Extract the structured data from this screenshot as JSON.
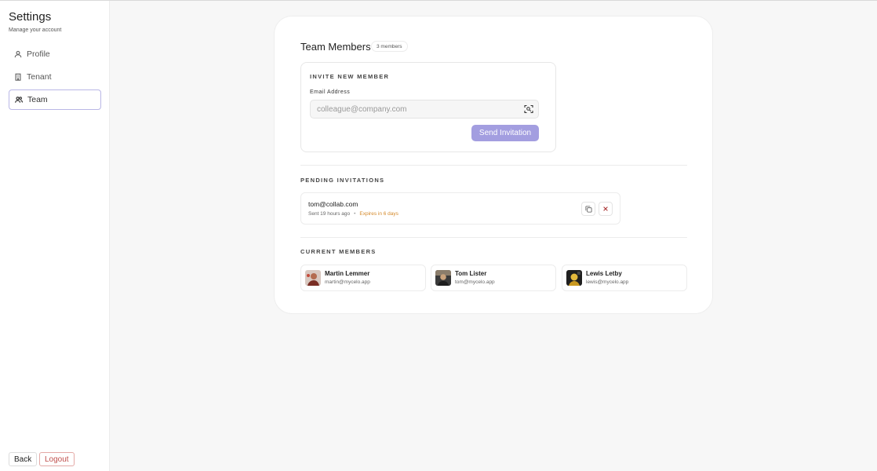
{
  "sidebar": {
    "title": "Settings",
    "subtitle": "Manage your account",
    "items": [
      {
        "label": "Profile",
        "icon": "user-icon"
      },
      {
        "label": "Tenant",
        "icon": "building-icon"
      },
      {
        "label": "Team",
        "icon": "users-icon",
        "active": true
      }
    ],
    "back_label": "Back",
    "logout_label": "Logout"
  },
  "team": {
    "title": "Team Members",
    "count_badge": "3 members",
    "invite": {
      "section_label": "INVITE NEW MEMBER",
      "email_label": "Email Address",
      "email_placeholder": "colleague@company.com",
      "email_value": "",
      "send_label": "Send Invitation"
    },
    "pending": {
      "section_label": "PENDING INVITATIONS",
      "items": [
        {
          "email": "tom@collab.com",
          "sent": "Sent 19 hours ago",
          "expires": "Expires in 6 days"
        }
      ]
    },
    "current": {
      "section_label": "CURRENT MEMBERS",
      "members": [
        {
          "name": "Martin Lemmer",
          "email": "martin@mycelo.app"
        },
        {
          "name": "Tom Lister",
          "email": "tom@mycelo.app"
        },
        {
          "name": "Lewis Letby",
          "email": "lewis@mycelo.app"
        }
      ]
    }
  },
  "colors": {
    "accent": "#a39ee0",
    "active_border": "#b9b7e6",
    "logout": "#c0504d",
    "expires": "#d4892a"
  }
}
